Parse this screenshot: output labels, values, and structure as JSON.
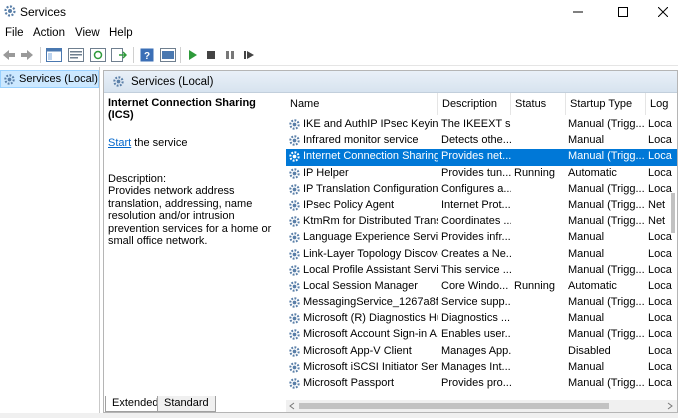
{
  "window": {
    "title": "Services",
    "icon": "gear-icon"
  },
  "menu": [
    "File",
    "Action",
    "View",
    "Help"
  ],
  "toolbar": [
    "back-arrow-icon",
    "forward-arrow-icon",
    "show-hide-tree-icon",
    "properties-icon",
    "refresh-icon",
    "export-list-icon",
    "help-icon",
    "console-icon",
    "start-icon",
    "stop-icon",
    "pause-icon",
    "restart-icon"
  ],
  "tree": {
    "label": "Services (Local)"
  },
  "panel": {
    "header": "Services (Local)"
  },
  "details": {
    "service_title": "Internet Connection Sharing (ICS)",
    "start_link": "Start",
    "start_suffix": " the service",
    "description_label": "Description:",
    "description": "Provides network address translation, addressing, name resolution and/or intrusion prevention services for a home or small office network."
  },
  "columns": [
    "Name",
    "Description",
    "Status",
    "Startup Type",
    "Log"
  ],
  "rows": [
    {
      "name": "IKE and AuthIP IPsec Keying ...",
      "desc": "The IKEEXT s...",
      "status": "",
      "startup": "Manual (Trigg...",
      "logon": "Loca"
    },
    {
      "name": "Infrared monitor service",
      "desc": "Detects othe...",
      "status": "",
      "startup": "Manual",
      "logon": "Loca"
    },
    {
      "name": "Internet Connection Sharing...",
      "desc": "Provides net...",
      "status": "",
      "startup": "Manual (Trigg...",
      "logon": "Loca",
      "selected": true
    },
    {
      "name": "IP Helper",
      "desc": "Provides tun...",
      "status": "Running",
      "startup": "Automatic",
      "logon": "Loca"
    },
    {
      "name": "IP Translation Configuration ...",
      "desc": "Configures a...",
      "status": "",
      "startup": "Manual (Trigg...",
      "logon": "Loca"
    },
    {
      "name": "IPsec Policy Agent",
      "desc": "Internet Prot...",
      "status": "",
      "startup": "Manual (Trigg...",
      "logon": "Net"
    },
    {
      "name": "KtmRm for Distributed Trans...",
      "desc": "Coordinates ...",
      "status": "",
      "startup": "Manual (Trigg...",
      "logon": "Net"
    },
    {
      "name": "Language Experience Service",
      "desc": "Provides infr...",
      "status": "",
      "startup": "Manual",
      "logon": "Loca"
    },
    {
      "name": "Link-Layer Topology Discove...",
      "desc": "Creates a Ne...",
      "status": "",
      "startup": "Manual",
      "logon": "Loca"
    },
    {
      "name": "Local Profile Assistant Service",
      "desc": "This service ...",
      "status": "",
      "startup": "Manual (Trigg...",
      "logon": "Loca"
    },
    {
      "name": "Local Session Manager",
      "desc": "Core Windo...",
      "status": "Running",
      "startup": "Automatic",
      "logon": "Loca"
    },
    {
      "name": "MessagingService_1267a8f",
      "desc": "Service supp...",
      "status": "",
      "startup": "Manual (Trigg...",
      "logon": "Loca"
    },
    {
      "name": "Microsoft (R) Diagnostics Hu...",
      "desc": "Diagnostics ...",
      "status": "",
      "startup": "Manual",
      "logon": "Loca"
    },
    {
      "name": "Microsoft Account Sign-in A...",
      "desc": "Enables user...",
      "status": "",
      "startup": "Manual (Trigg...",
      "logon": "Loca"
    },
    {
      "name": "Microsoft App-V Client",
      "desc": "Manages App...",
      "status": "",
      "startup": "Disabled",
      "logon": "Loca"
    },
    {
      "name": "Microsoft iSCSI Initiator Serv...",
      "desc": "Manages Int...",
      "status": "",
      "startup": "Manual",
      "logon": "Loca"
    },
    {
      "name": "Microsoft Passport",
      "desc": "Provides pro...",
      "status": "",
      "startup": "Manual (Trigg...",
      "logon": "Loca"
    }
  ],
  "tabs": [
    "Extended",
    "Standard"
  ],
  "colors": {
    "selection": "#0078d7",
    "link": "#0066cc",
    "tree_selection": "#cce8ff"
  }
}
